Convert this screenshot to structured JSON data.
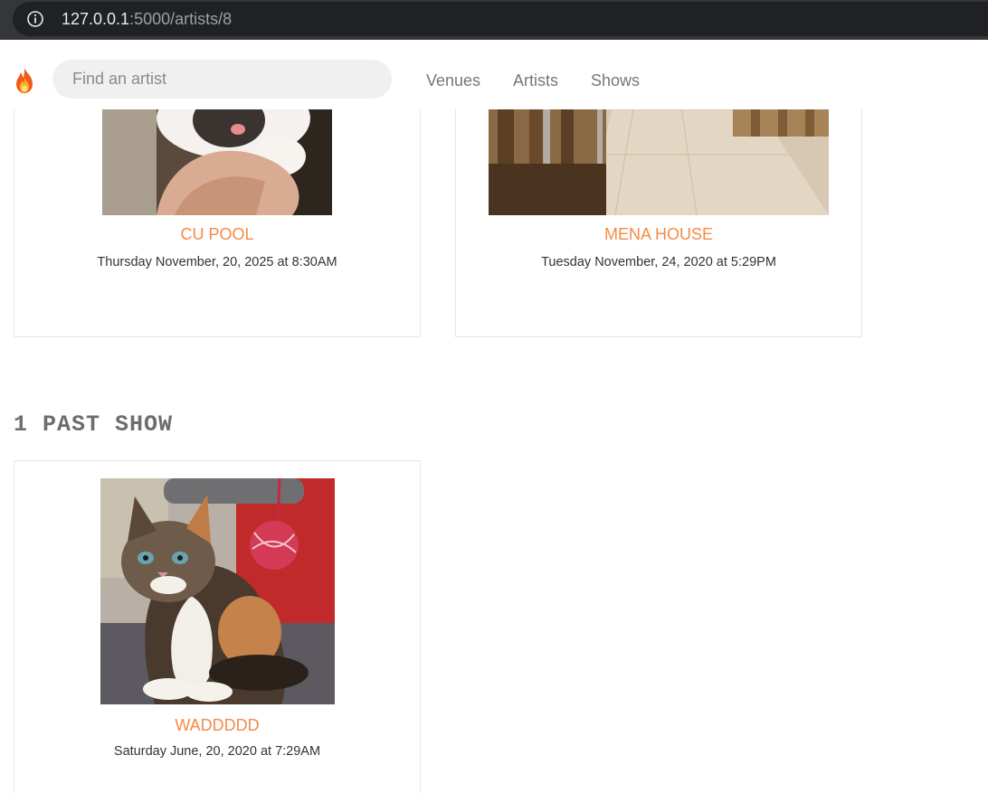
{
  "browser": {
    "url_host": "127.0.0.1",
    "url_rest": ":5000/artists/8"
  },
  "navbar": {
    "search_placeholder": "Find an artist",
    "links": [
      "Venues",
      "Artists",
      "Shows"
    ]
  },
  "upcoming_shows": [
    {
      "venue": "CU POOL",
      "date": "Thursday November, 20, 2025 at 8:30AM",
      "image": "kitten-on-hand"
    },
    {
      "venue": "MENA HOUSE",
      "date": "Tuesday November, 24, 2020 at 5:29PM",
      "image": "wedding-aisle"
    }
  ],
  "past_shows_heading": "1 PAST SHOW",
  "past_shows": [
    {
      "venue": "WADDDDD",
      "date": "Saturday June, 20, 2020 at 7:29AM",
      "image": "calico-kitten-with-yarn-ball"
    }
  ],
  "colors": {
    "accent": "#f58a45",
    "browser_bar": "#35363a",
    "search_bg": "#f0f0f0"
  }
}
